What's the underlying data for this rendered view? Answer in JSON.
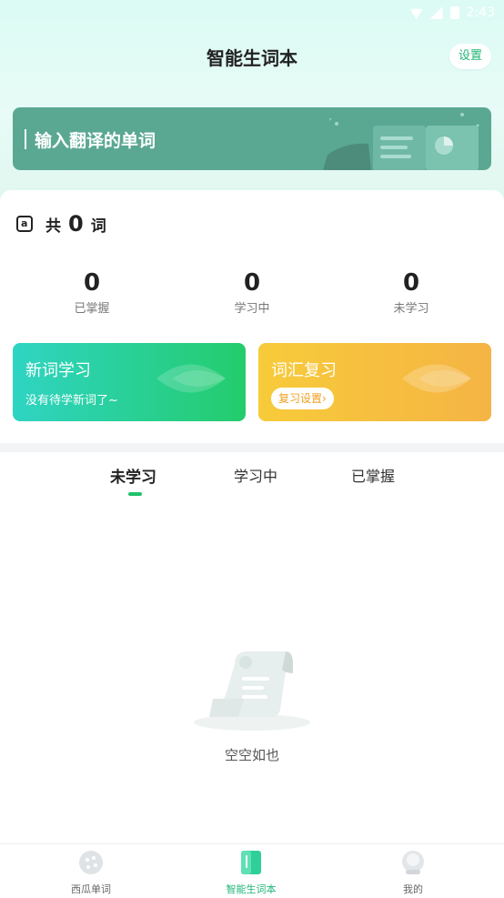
{
  "status_bar": {
    "time": "2:43"
  },
  "header": {
    "title": "智能生词本",
    "settings_label": "设置"
  },
  "banner": {
    "prompt": "输入翻译的单词"
  },
  "summary": {
    "prefix": "共",
    "total": "0",
    "suffix": "词"
  },
  "stats": [
    {
      "value": "0",
      "label": "已掌握"
    },
    {
      "value": "0",
      "label": "学习中"
    },
    {
      "value": "0",
      "label": "未学习"
    }
  ],
  "actions": {
    "new_words": {
      "title": "新词学习",
      "subtitle": "没有待学新词了~"
    },
    "review": {
      "title": "词汇复习",
      "settings_label": "复习设置"
    }
  },
  "tabs": [
    {
      "label": "未学习",
      "active": true
    },
    {
      "label": "学习中",
      "active": false
    },
    {
      "label": "已掌握",
      "active": false
    }
  ],
  "empty_state": {
    "text": "空空如也"
  },
  "bottom_nav": [
    {
      "label": "西瓜单词",
      "icon": "melon-icon",
      "active": false
    },
    {
      "label": "智能生词本",
      "icon": "notebook-icon",
      "active": true
    },
    {
      "label": "我的",
      "icon": "profile-icon",
      "active": false
    }
  ],
  "colors": {
    "accent_green": "#1fc26a",
    "banner_bg": "#5aa892",
    "review_orange": "#f5b444"
  }
}
